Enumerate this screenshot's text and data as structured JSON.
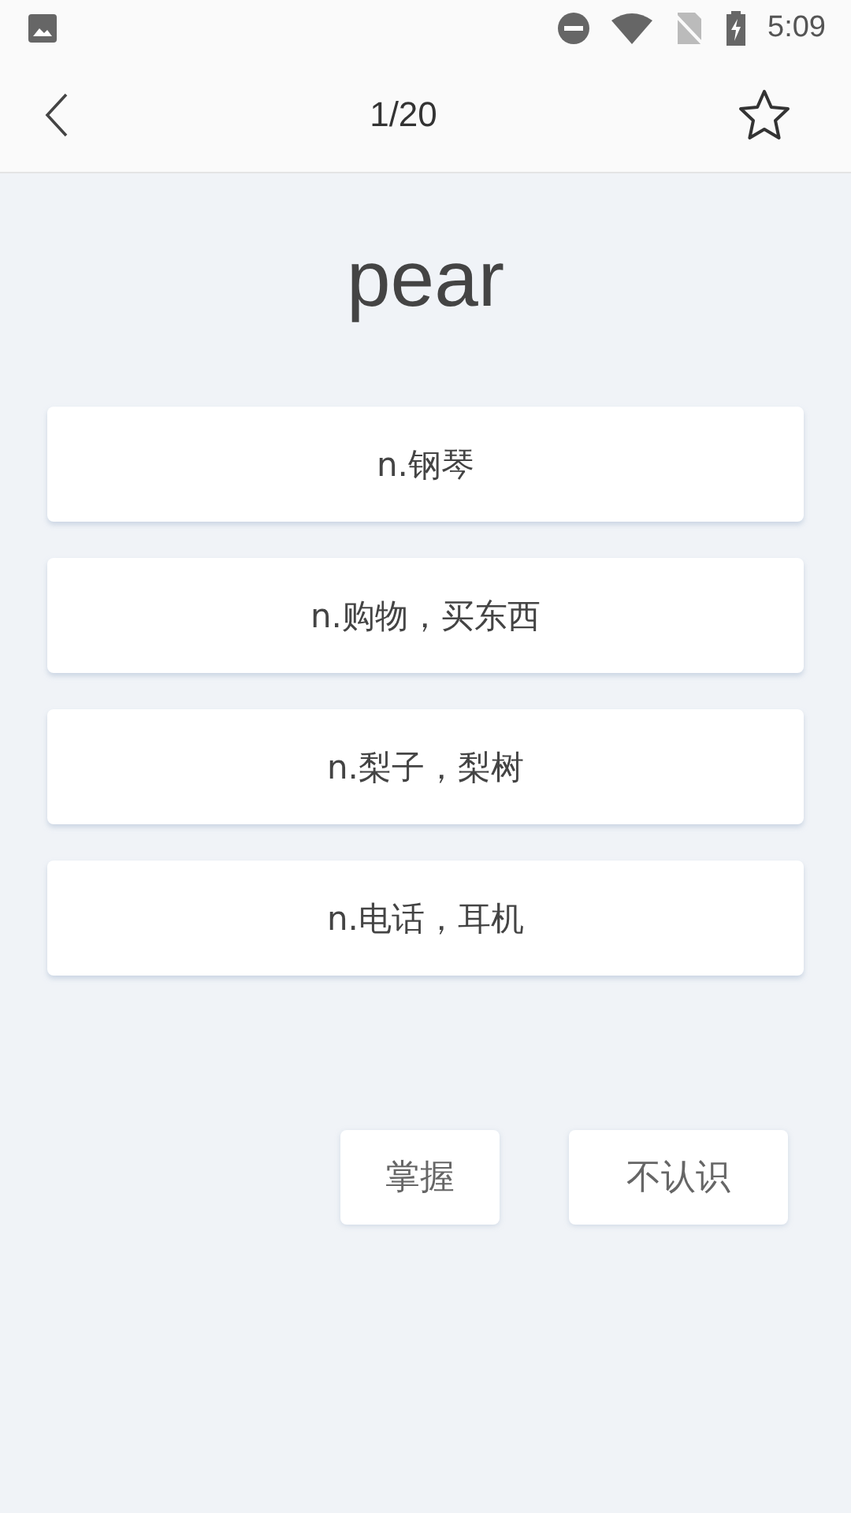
{
  "status_bar": {
    "time": "5:09"
  },
  "header": {
    "progress": "1/20",
    "favorited": false
  },
  "word": "pear",
  "options": [
    {
      "text": "n.钢琴"
    },
    {
      "text": "n.购物，买东西"
    },
    {
      "text": "n.梨子，梨树"
    },
    {
      "text": "n.电话，耳机"
    }
  ],
  "buttons": [
    {
      "label": "掌握"
    },
    {
      "label": "不认识"
    }
  ]
}
